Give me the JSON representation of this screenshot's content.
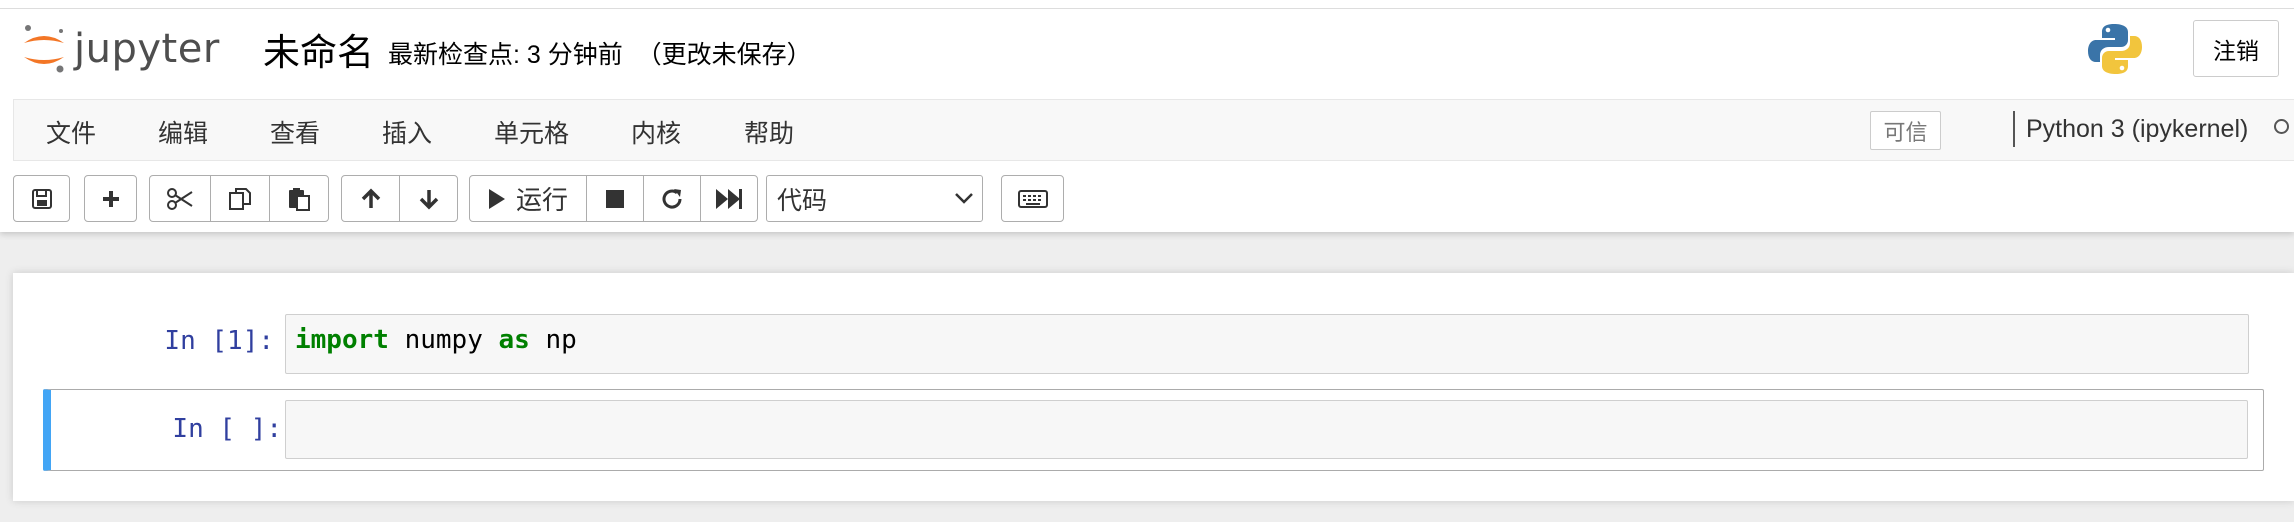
{
  "header": {
    "logo_text": "jupyter",
    "notebook_name": "未命名",
    "checkpoint": "最新检查点: 3 分钟前  （更改未保存）",
    "logout_label": "注销"
  },
  "menubar": {
    "items": [
      "文件",
      "编辑",
      "查看",
      "插入",
      "单元格",
      "内核",
      "帮助"
    ],
    "trusted_label": "可信",
    "kernel_name": "Python 3 (ipykernel)"
  },
  "toolbar": {
    "run_label": "运行",
    "cell_type": "代码",
    "icons": [
      "save-icon",
      "plus-icon",
      "cut-icon",
      "copy-icon",
      "paste-icon",
      "arrow-up-icon",
      "arrow-down-icon",
      "play-icon",
      "stop-icon",
      "restart-icon",
      "fast-forward-icon",
      "keyboard-icon"
    ]
  },
  "cells": [
    {
      "prompt": "In [1]:",
      "code": {
        "kw1": "import",
        "mid": " numpy ",
        "kw2": "as",
        "end": " np"
      }
    },
    {
      "prompt": "In [ ]:",
      "code": ""
    }
  ],
  "colors": {
    "accent_selected": "#42a5f5",
    "prompt": "#303f9f",
    "keyword": "#008000",
    "jupyter_orange": "#f37626"
  }
}
